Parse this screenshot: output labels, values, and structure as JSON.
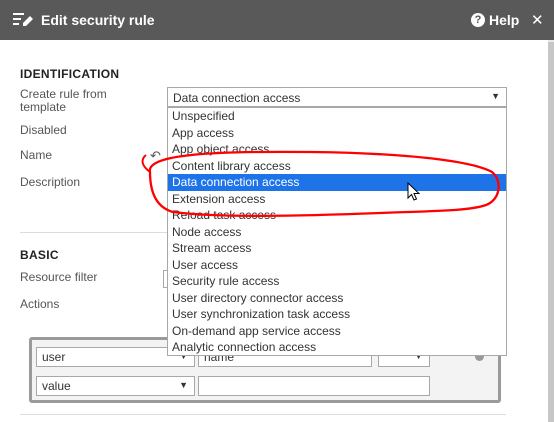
{
  "header": {
    "title": "Edit security rule",
    "help_label": "Help",
    "colors": {
      "bar": "#595959",
      "text": "#ffffff"
    }
  },
  "identification": {
    "section_title": "IDENTIFICATION",
    "template_label": "Create rule from template",
    "template_selected": "Data connection access",
    "disabled_label": "Disabled",
    "name_label": "Name",
    "description_label": "Description"
  },
  "template_dropdown": {
    "options": [
      "Unspecified",
      "App access",
      "App object access",
      "Content library access",
      "Data connection access",
      "Extension access",
      "Reload task access",
      "Node access",
      "Stream access",
      "User access",
      "Security rule access",
      "User directory connector access",
      "User synchronization task access",
      "On-demand app service access",
      "Analytic connection access"
    ],
    "highlighted_option": "Data connection access",
    "highlight_color": "#1e73e8"
  },
  "basic": {
    "section_title": "BASIC",
    "resource_filter_label": "Resource filter",
    "actions_label": "Actions"
  },
  "conditions": {
    "row1_left": "user",
    "row1_middle": "name",
    "row2_left": "value",
    "row2_right": ""
  },
  "annotation": {
    "stroke_color": "#ff0000"
  },
  "icons": {
    "menu": "edit-list-icon",
    "help": "help-icon",
    "close": "close-icon",
    "undo": "undo-icon",
    "caret": "chevron-down-icon",
    "cursor": "mouse-pointer-icon"
  }
}
